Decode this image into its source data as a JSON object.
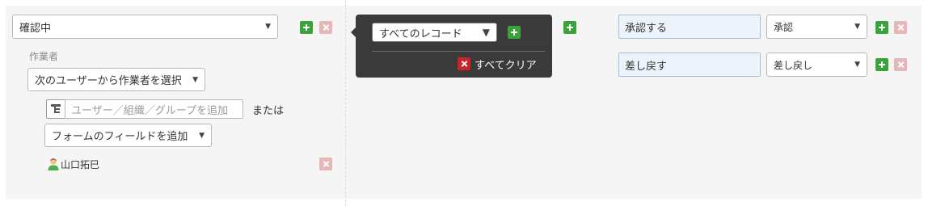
{
  "status": {
    "selected": "確認中"
  },
  "assignee": {
    "section_label": "作業者",
    "method_select": "次のユーザーから作業者を選択",
    "user_input_placeholder": "ユーザー／組織／グループを追加",
    "or_label": "または",
    "field_select": "フォームのフィールドを追加",
    "users": [
      {
        "name": "山口拓巳"
      }
    ]
  },
  "condition": {
    "record_select": "すべてのレコード",
    "clear_all_label": "すべてクリア"
  },
  "actions": [
    {
      "name": "承認する",
      "status_after": "承認"
    },
    {
      "name": "差し戻す",
      "status_after": "差し戻し"
    }
  ]
}
